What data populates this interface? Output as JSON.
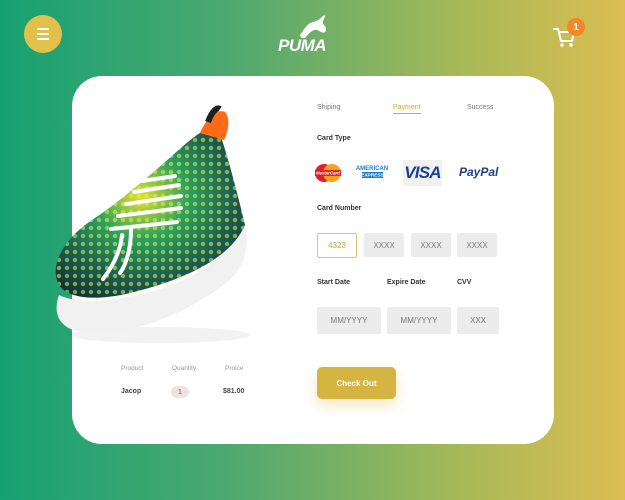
{
  "brand": {
    "name": "PUMA"
  },
  "header": {
    "cart_count": "1",
    "menu_icon": "hamburger-icon",
    "cart_icon": "cart-icon"
  },
  "steps": [
    {
      "label": "Shiping"
    },
    {
      "label": "Payment"
    },
    {
      "label": "Success"
    }
  ],
  "payment": {
    "card_type_label": "Card Type",
    "card_brands": [
      "MasterCard",
      "AMERICAN EXPRESS",
      "VISA",
      "PayPal"
    ],
    "card_number_label": "Card Number",
    "card_number": [
      "4323",
      "XXXX",
      "XXXX",
      "XXXX"
    ],
    "start_date_label": "Start Date",
    "expire_date_label": "Expire  Date",
    "cvv_label": "CVV",
    "start_date_placeholder": "MM/YYYY",
    "expire_date_placeholder": "MM/YYYY",
    "cvv_placeholder": "XXX",
    "checkout_label": "Check Out"
  },
  "order": {
    "headers": [
      "Product",
      "Quantity",
      "Proice"
    ],
    "product": "Jacop",
    "quantity": "1",
    "price": "$81.00"
  },
  "colors": {
    "accent": "#d5b542",
    "badge": "#f5862a",
    "bg_left": "#17a173",
    "bg_right": "#dcbd52"
  }
}
